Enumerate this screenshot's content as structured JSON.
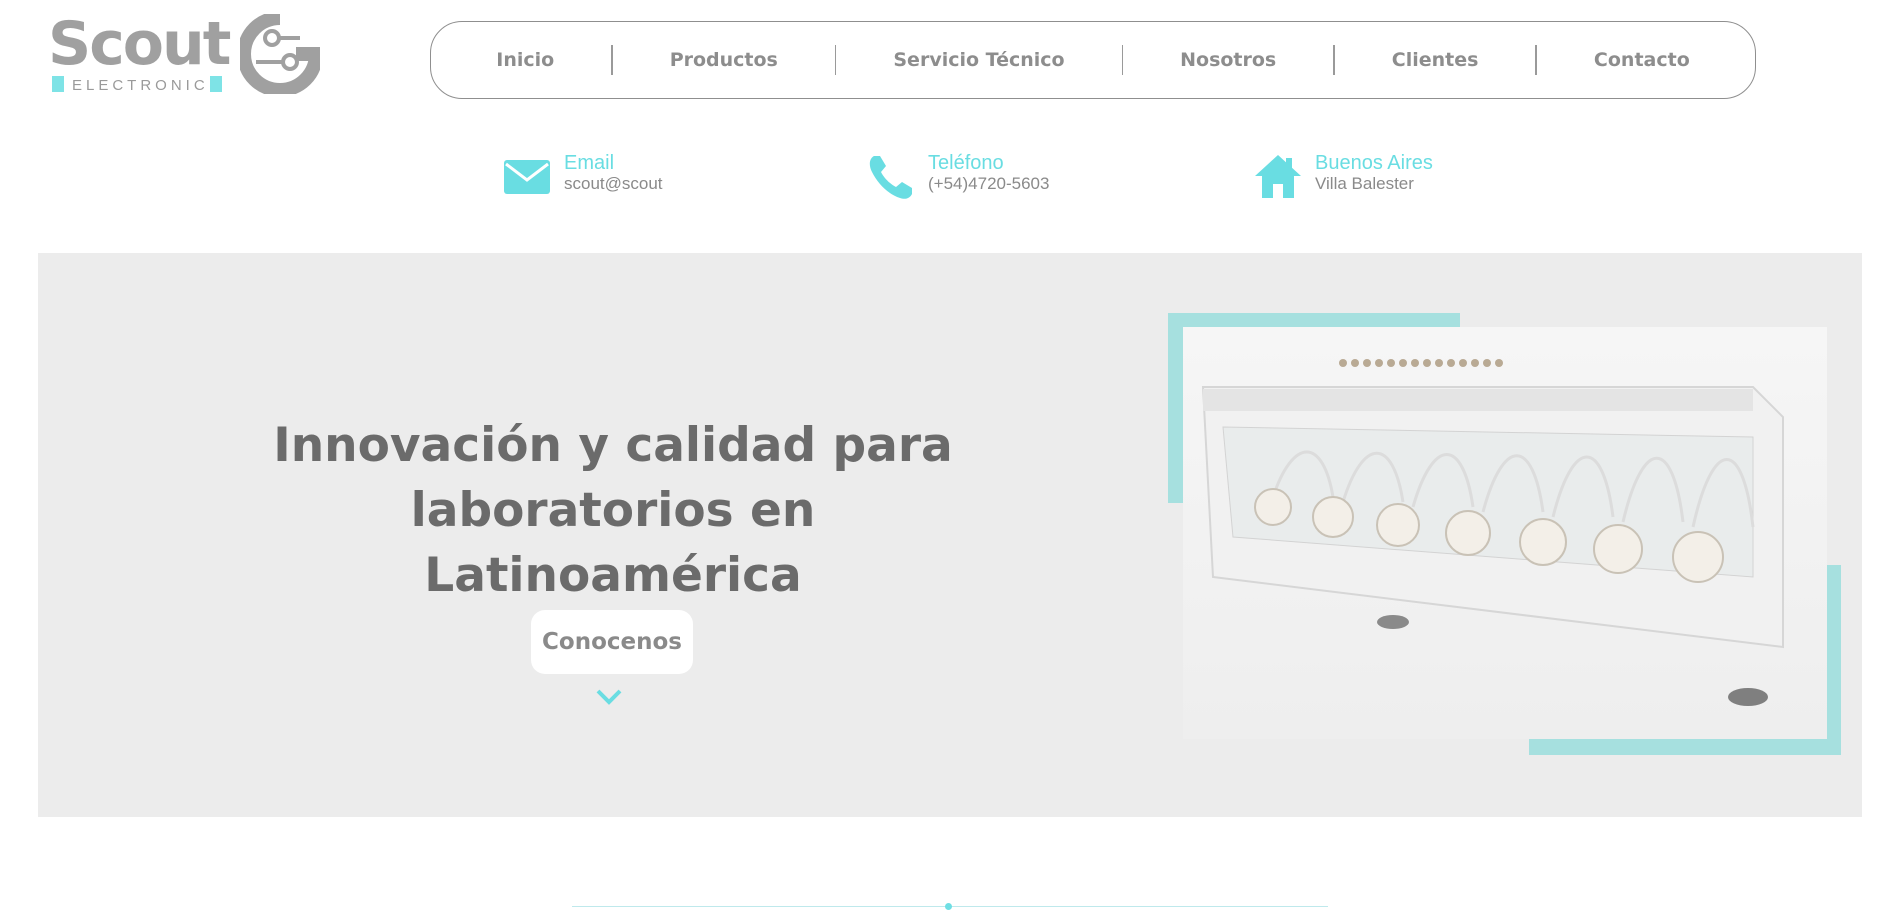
{
  "brand": {
    "name": "Scout",
    "tagline": "ELECTRONIC",
    "accent_color": "#69dde2"
  },
  "nav": {
    "items": [
      {
        "label": "Inicio"
      },
      {
        "label": "Productos"
      },
      {
        "label": "Servicio Técnico"
      },
      {
        "label": "Nosotros"
      },
      {
        "label": "Clientes"
      },
      {
        "label": "Contacto"
      }
    ]
  },
  "contact": {
    "email": {
      "icon": "envelope-icon",
      "title": "Email",
      "value": "scout@scout"
    },
    "phone": {
      "icon": "phone-icon",
      "title": "Teléfono",
      "value": "(+54)4720-5603"
    },
    "location": {
      "icon": "house-icon",
      "title": "Buenos Aires",
      "value": "Villa Balester"
    }
  },
  "hero": {
    "title_line1": "Innovación y calidad para laboratorios en",
    "title_line2": "Latinoamérica",
    "cta_label": "Conocenos",
    "cta_icon": "chevron-down-icon",
    "image_icon": "peristaltic-pump-photo"
  }
}
